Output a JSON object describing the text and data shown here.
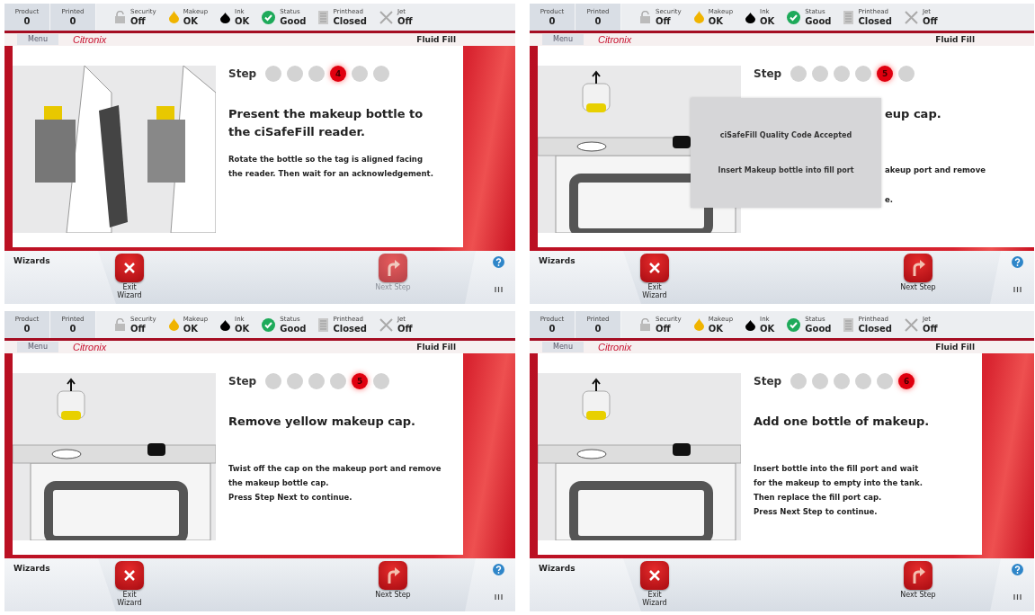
{
  "panels": [
    {
      "status_bar": {
        "counters": [
          {
            "label": "Product",
            "value": "0"
          },
          {
            "label": "Printed",
            "value": "0"
          }
        ],
        "indicators": [
          {
            "kind": "lock",
            "label": "Security",
            "value": "Off"
          },
          {
            "kind": "makeup",
            "label": "Makeup",
            "value": "OK"
          },
          {
            "kind": "ink",
            "label": "Ink",
            "value": "OK"
          },
          {
            "kind": "status",
            "label": "Status",
            "value": "Good"
          },
          {
            "kind": "printhead",
            "label": "Printhead",
            "value": "Closed"
          },
          {
            "kind": "jet",
            "label": "Jet",
            "value": "Off"
          }
        ]
      },
      "menu_tab": "Menu",
      "logo": "Citronix",
      "screen_title": "Fluid Fill",
      "step": {
        "label": "Step",
        "dots": [
          {
            "selected": false
          },
          {
            "selected": false
          },
          {
            "selected": false
          },
          {
            "selected": true,
            "number": "4"
          },
          {
            "selected": false
          },
          {
            "selected": false
          }
        ]
      },
      "heading": "Present the makeup bottle to the ciSafeFill reader.",
      "body": [
        "Rotate the bottle so the tag is aligned facing",
        "the reader. Then wait for an acknowledgement."
      ],
      "bottom_bar": {
        "title": "Wizards",
        "buttons": [
          {
            "kind": "exit",
            "label": "Exit Wizard",
            "disabled": false
          },
          {
            "kind": "next",
            "label": "Next Step",
            "disabled": true
          }
        ]
      }
    },
    {
      "status_bar": {
        "counters": [
          {
            "label": "Product",
            "value": "0"
          },
          {
            "label": "Printed",
            "value": "0"
          }
        ],
        "indicators": [
          {
            "kind": "lock",
            "label": "Security",
            "value": "Off"
          },
          {
            "kind": "makeup",
            "label": "Makeup",
            "value": "OK"
          },
          {
            "kind": "ink",
            "label": "Ink",
            "value": "OK"
          },
          {
            "kind": "status",
            "label": "Status",
            "value": "Good"
          },
          {
            "kind": "printhead",
            "label": "Printhead",
            "value": "Closed"
          },
          {
            "kind": "jet",
            "label": "Jet",
            "value": "Off"
          }
        ]
      },
      "menu_tab": "Menu",
      "logo": "Citronix",
      "screen_title": "Fluid Fill",
      "step": {
        "label": "Step",
        "dots": [
          {
            "selected": false
          },
          {
            "selected": false
          },
          {
            "selected": false
          },
          {
            "selected": false
          },
          {
            "selected": true,
            "number": "5"
          },
          {
            "selected": false
          }
        ]
      },
      "heading": "eup cap.",
      "body": [
        "akeup port and remove",
        "e."
      ],
      "dialog": {
        "lines": [
          "ciSafeFill Quality Code Accepted",
          "Insert Makeup bottle into fill port"
        ]
      },
      "bottom_bar": {
        "title": "Wizards",
        "buttons": [
          {
            "kind": "exit",
            "label": "Exit Wizard",
            "disabled": false
          },
          {
            "kind": "next",
            "label": "Next Step",
            "disabled": false
          }
        ]
      }
    },
    {
      "status_bar": {
        "counters": [
          {
            "label": "Product",
            "value": "0"
          },
          {
            "label": "Printed",
            "value": "0"
          }
        ],
        "indicators": [
          {
            "kind": "lock",
            "label": "Security",
            "value": "Off"
          },
          {
            "kind": "makeup",
            "label": "Makeup",
            "value": "OK"
          },
          {
            "kind": "ink",
            "label": "Ink",
            "value": "OK"
          },
          {
            "kind": "status",
            "label": "Status",
            "value": "Good"
          },
          {
            "kind": "printhead",
            "label": "Printhead",
            "value": "Closed"
          },
          {
            "kind": "jet",
            "label": "Jet",
            "value": "Off"
          }
        ]
      },
      "menu_tab": "Menu",
      "logo": "Citronix",
      "screen_title": "Fluid Fill",
      "step": {
        "label": "Step",
        "dots": [
          {
            "selected": false
          },
          {
            "selected": false
          },
          {
            "selected": false
          },
          {
            "selected": false
          },
          {
            "selected": true,
            "number": "5"
          },
          {
            "selected": false
          }
        ]
      },
      "heading": "Remove yellow makeup cap.",
      "body": [
        "Twist off the cap on the makeup port and remove",
        "the makeup bottle cap.",
        "Press Step Next to continue."
      ],
      "bottom_bar": {
        "title": "Wizards",
        "buttons": [
          {
            "kind": "exit",
            "label": "Exit Wizard",
            "disabled": false
          },
          {
            "kind": "next",
            "label": "Next Step",
            "disabled": false
          }
        ]
      }
    },
    {
      "status_bar": {
        "counters": [
          {
            "label": "Product",
            "value": "0"
          },
          {
            "label": "Printed",
            "value": "0"
          }
        ],
        "indicators": [
          {
            "kind": "lock",
            "label": "Security",
            "value": "Off"
          },
          {
            "kind": "makeup",
            "label": "Makeup",
            "value": "OK"
          },
          {
            "kind": "ink",
            "label": "Ink",
            "value": "OK"
          },
          {
            "kind": "status",
            "label": "Status",
            "value": "Good"
          },
          {
            "kind": "printhead",
            "label": "Printhead",
            "value": "Closed"
          },
          {
            "kind": "jet",
            "label": "Jet",
            "value": "Off"
          }
        ]
      },
      "menu_tab": "Menu",
      "logo": "Citronix",
      "screen_title": "Fluid Fill",
      "step": {
        "label": "Step",
        "dots": [
          {
            "selected": false
          },
          {
            "selected": false
          },
          {
            "selected": false
          },
          {
            "selected": false
          },
          {
            "selected": false
          },
          {
            "selected": true,
            "number": "6"
          }
        ]
      },
      "heading": "Add one bottle of makeup.",
      "body": [
        "Insert bottle into the fill port and wait",
        "for the makeup to empty into the tank.",
        "Then replace the fill port cap.",
        "Press Next Step to continue."
      ],
      "bottom_bar": {
        "title": "Wizards",
        "buttons": [
          {
            "kind": "exit",
            "label": "Exit Wizard",
            "disabled": false
          },
          {
            "kind": "next",
            "label": "Next Step",
            "disabled": false
          }
        ]
      }
    }
  ]
}
